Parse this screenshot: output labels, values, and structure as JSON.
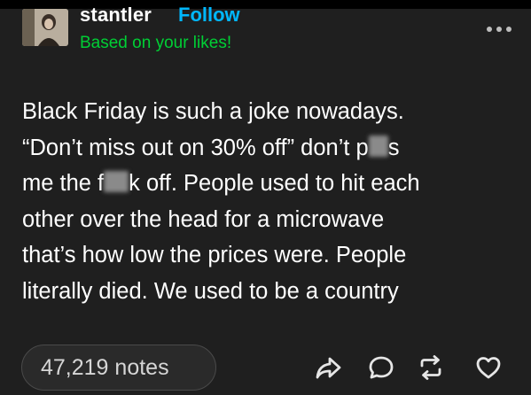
{
  "header": {
    "username": "stantler",
    "follow_label": "Follow",
    "subtitle": "Based on your likes!",
    "more_icon": "more-horizontal-icon",
    "avatar": "user-avatar-photo"
  },
  "post": {
    "lines": [
      {
        "text": "Black Friday is such a joke nowadays."
      },
      {
        "text": "“Don’t miss out on 30% off” don’t p",
        "censored_tail": "s"
      },
      {
        "text_a": "me the f",
        "text_b": "k off. People used to hit each"
      },
      {
        "text": "other over the head for a microwave"
      },
      {
        "text": "that’s how low the prices were. People"
      },
      {
        "text": "literally died. We used to be a country"
      }
    ]
  },
  "footer": {
    "notes_label": "47,219 notes",
    "actions": [
      "share-icon",
      "reply-icon",
      "reblog-icon",
      "like-icon"
    ]
  },
  "colors": {
    "background": "#1f1f1f",
    "text": "#ffffff",
    "follow_accent": "#00b8ff",
    "subtitle_accent": "#00cf35",
    "muted": "#d6d6d6"
  }
}
